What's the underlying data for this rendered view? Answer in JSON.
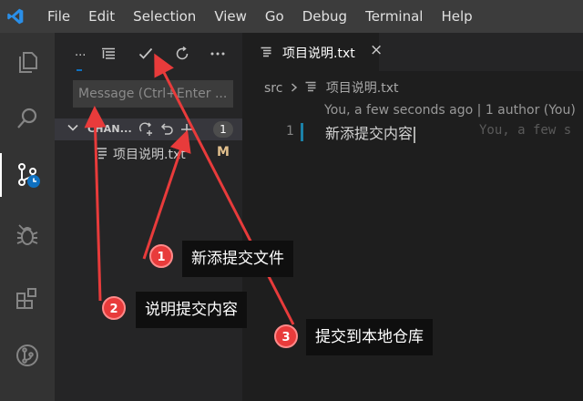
{
  "menubar": {
    "items": [
      "File",
      "Edit",
      "Selection",
      "View",
      "Go",
      "Debug",
      "Terminal",
      "Help"
    ]
  },
  "activitybar": {
    "items": [
      "explorer-icon",
      "search-icon",
      "source-control-icon",
      "debug-icon",
      "extensions-icon",
      "git-graph-icon"
    ],
    "active": "source-control-icon"
  },
  "scm": {
    "title": "...",
    "toolbar": [
      "list-tree-icon",
      "commit-check-icon",
      "refresh-icon",
      "more-actions-icon"
    ],
    "message_placeholder": "Message (Ctrl+Enter ...",
    "changes_label": "CHAN...",
    "changes_count": "1",
    "file": {
      "name": "项目说明.txt",
      "status": "M"
    }
  },
  "editor": {
    "tab_label": "项目说明.txt",
    "tab_close": "×",
    "breadcrumb": {
      "folder": "src",
      "file": "项目说明.txt"
    },
    "codelens": "You, a few seconds ago | 1 author (You)",
    "line_number": "1",
    "code": "新添提交内容",
    "blame": "You, a few s"
  },
  "annotations": [
    {
      "number": "1",
      "text": "新添提交文件"
    },
    {
      "number": "2",
      "text": "说明提交内容"
    },
    {
      "number": "3",
      "text": "提交到本地仓库"
    }
  ],
  "colors": {
    "accent": "#0e70c0",
    "annotation_red": "#e83b3b",
    "modified": "#e2c08d",
    "vscode_blue": "#2a8fe8"
  }
}
